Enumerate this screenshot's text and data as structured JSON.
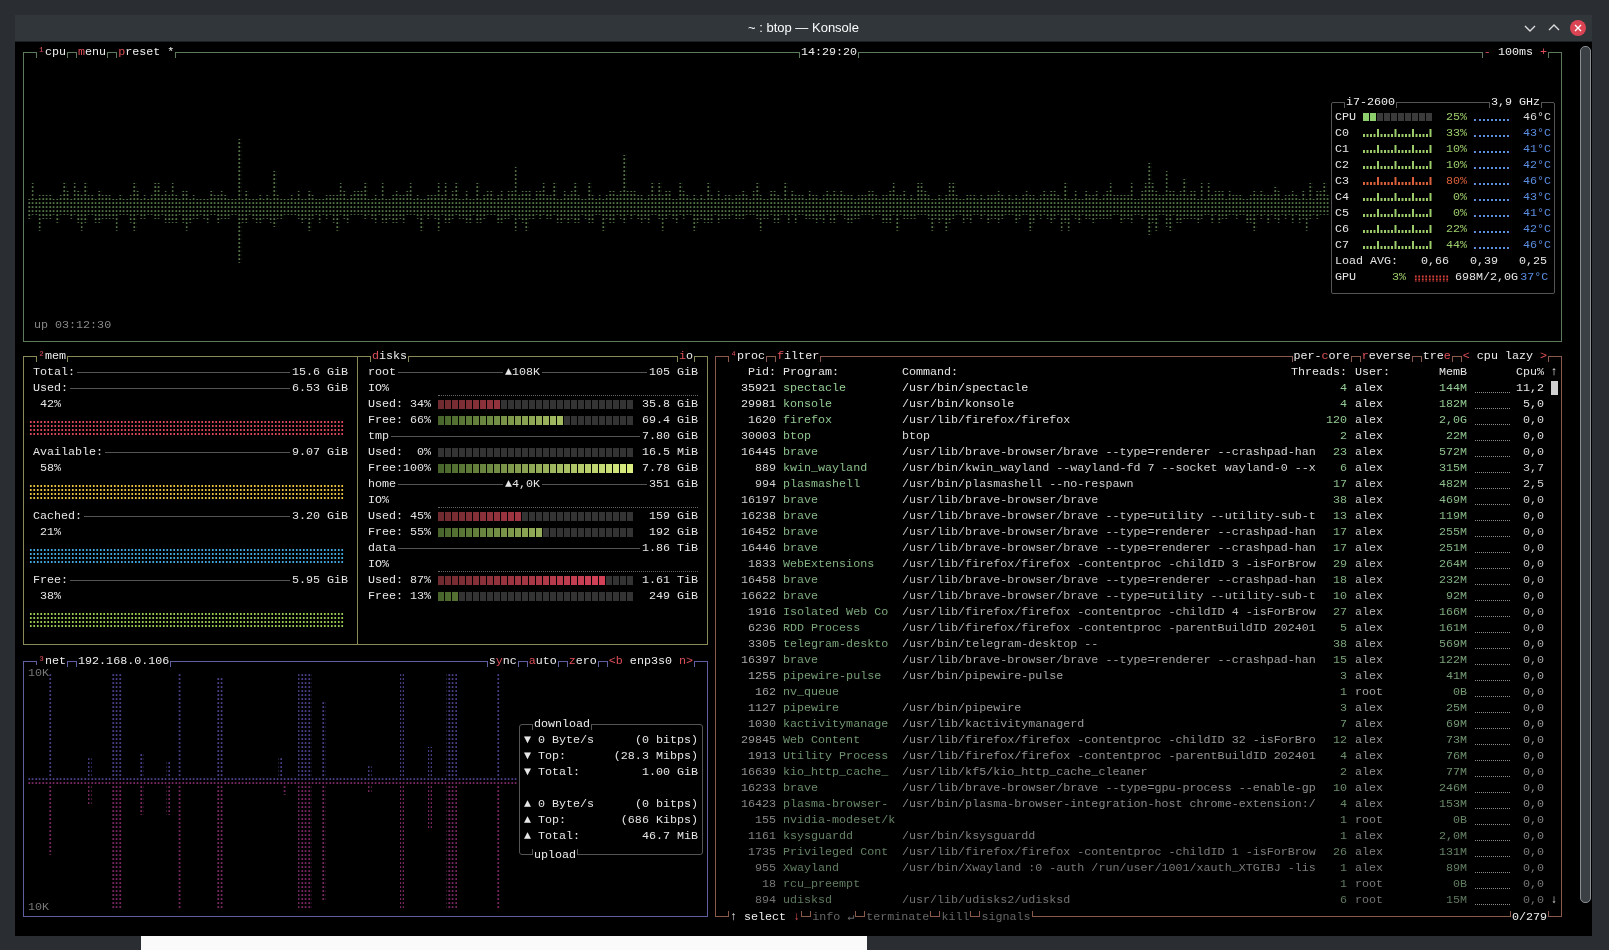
{
  "window": {
    "title": "~ : btop — Konsole"
  },
  "cpu": {
    "tabs": [
      "**¹**cpu",
      "**m**enu",
      "**p**reset *"
    ],
    "clock": "14:29:20",
    "interval": "**-** 100ms **+**",
    "uptime": "up 03:12:30",
    "stats": {
      "model": "i7-2600",
      "freq": "3,9 GHz",
      "total": {
        "label": "CPU",
        "level": 0.25,
        "percent": "25%",
        "temp": "46°C"
      },
      "cores": [
        {
          "label": "C0",
          "percent": "33%",
          "color": "#9ccc6a",
          "temp": "43°C"
        },
        {
          "label": "C1",
          "percent": "10%",
          "color": "#9ccc6a",
          "temp": "41°C"
        },
        {
          "label": "C2",
          "percent": "10%",
          "color": "#9ccc6a",
          "temp": "42°C"
        },
        {
          "label": "C3",
          "percent": "80%",
          "color": "#d9603b",
          "temp": "46°C"
        },
        {
          "label": "C4",
          "percent": "0%",
          "color": "#9ccc6a",
          "temp": "43°C"
        },
        {
          "label": "C5",
          "percent": "0%",
          "color": "#9ccc6a",
          "temp": "41°C"
        },
        {
          "label": "C6",
          "percent": "22%",
          "color": "#9ccc6a",
          "temp": "42°C"
        },
        {
          "label": "C7",
          "percent": "44%",
          "color": "#9ccc6a",
          "temp": "46°C"
        }
      ],
      "load": {
        "label": "Load AVG:",
        "values": [
          "0,66",
          "0,39",
          "0,25"
        ]
      },
      "gpu": {
        "label": "GPU",
        "percent": "3%",
        "memory": "698M/2,0G",
        "temp": "37°C"
      }
    }
  },
  "mem": {
    "title": "**²**mem",
    "items": [
      {
        "kind": "total",
        "label": "Total:",
        "value": "15.6 GiB"
      },
      {
        "kind": "meter",
        "label": "Used:",
        "value": "6.53 GiB",
        "percent": "42%",
        "color": "#d9485a"
      },
      {
        "kind": "meter",
        "label": "Available:",
        "value": "9.07 GiB",
        "percent": "58%",
        "color": "#e8c040"
      },
      {
        "kind": "meter",
        "label": "Cached:",
        "value": "3.20 GiB",
        "percent": "21%",
        "color": "#40a8e0"
      },
      {
        "kind": "meter",
        "label": "Free:",
        "value": "5.95 GiB",
        "percent": "38%",
        "color": "#98c850"
      }
    ]
  },
  "disks": {
    "title": "**d**isks",
    "io_title": "**i**o",
    "items": [
      {
        "name": "root",
        "io": "▲108K",
        "size": "105 GiB",
        "io_label": "IO%",
        "used": {
          "label": "Used: 34%",
          "level": 0.34,
          "value": "35.8 GiB"
        },
        "free": {
          "label": "Free: 66%",
          "level": 0.66,
          "value": "69.4 GiB"
        }
      },
      {
        "name": "tmp",
        "size": "7.80 GiB",
        "used": {
          "label": "Used:  0%",
          "level": 0,
          "value": "16.5 MiB"
        },
        "free": {
          "label": "Free:100%",
          "level": 1,
          "value": "7.78 GiB"
        }
      },
      {
        "name": "home",
        "io": "▲4,0K",
        "size": "351 GiB",
        "io_label": "IO%",
        "used": {
          "label": "Used: 45%",
          "level": 0.45,
          "value": "159 GiB"
        },
        "free": {
          "label": "Free: 55%",
          "level": 0.55,
          "value": "192 GiB"
        }
      },
      {
        "name": "data",
        "size": "1.86 TiB",
        "io_label": "IO%",
        "used": {
          "label": "Used: 87%",
          "level": 0.87,
          "value": "1.61 TiB"
        },
        "free": {
          "label": "Free: 13%",
          "level": 0.13,
          "value": "249 GiB"
        }
      }
    ]
  },
  "net": {
    "title": "**³**net",
    "address": "192.168.0.106",
    "options": [
      "s**y**nc",
      "**a**uto",
      "**z**ero",
      "**<b** enp3s0 **n>**"
    ],
    "scale_top": "10K",
    "scale_bottom": "10K",
    "download": {
      "title": "download",
      "rows": [
        {
          "arrow": "▼",
          "label": "0 Byte/s",
          "value": "(0 bitps)"
        },
        {
          "arrow": "▼",
          "label": "Top:",
          "value": "(28.3 Mibps)"
        },
        {
          "arrow": "▼",
          "label": "Total:",
          "value": "1.00 GiB"
        }
      ]
    },
    "upload": {
      "title": "upload",
      "rows": [
        {
          "arrow": "▲",
          "label": "0 Byte/s",
          "value": "(0 bitps)"
        },
        {
          "arrow": "▲",
          "label": "Top:",
          "value": "(686 Kibps)"
        },
        {
          "arrow": "▲",
          "label": "Total:",
          "value": "46.7 MiB"
        }
      ]
    }
  },
  "proc": {
    "title": "**⁴**proc",
    "filter": "**f**ilter",
    "options": [
      "per-**c**ore",
      "**r**everse",
      "tre**e**",
      "**<** cpu lazy **>**"
    ],
    "columns": [
      "Pid:",
      "Program:",
      "Command:",
      "Threads:",
      "User:",
      "MemB",
      "Cpu%"
    ],
    "scroll_up": "↑",
    "scroll_down": "↓",
    "rows": [
      {
        "pid": "35921",
        "program": "spectacle",
        "command": "/usr/bin/spectacle",
        "threads": "4",
        "user": "alex",
        "mem": "144M",
        "cpu": "11,2"
      },
      {
        "pid": "29981",
        "program": "konsole",
        "command": "/usr/bin/konsole",
        "threads": "4",
        "user": "alex",
        "mem": "182M",
        "cpu": "5,0"
      },
      {
        "pid": "1620",
        "program": "firefox",
        "command": "/usr/lib/firefox/firefox",
        "threads": "120",
        "user": "alex",
        "mem": "2,0G",
        "cpu": "0,0"
      },
      {
        "pid": "30003",
        "program": "btop",
        "command": "btop",
        "threads": "2",
        "user": "alex",
        "mem": "22M",
        "cpu": "0,0"
      },
      {
        "pid": "16445",
        "program": "brave",
        "command": "/usr/lib/brave-browser/brave --type=renderer --crashpad-han",
        "threads": "23",
        "user": "alex",
        "mem": "572M",
        "cpu": "0,0"
      },
      {
        "pid": "889",
        "program": "kwin_wayland",
        "command": "/usr/bin/kwin_wayland --wayland-fd 7 --socket wayland-0 --x",
        "threads": "6",
        "user": "alex",
        "mem": "315M",
        "cpu": "3,7"
      },
      {
        "pid": "994",
        "program": "plasmashell",
        "command": "/usr/bin/plasmashell --no-respawn",
        "threads": "17",
        "user": "alex",
        "mem": "482M",
        "cpu": "2,5"
      },
      {
        "pid": "16197",
        "program": "brave",
        "command": "/usr/lib/brave-browser/brave",
        "threads": "38",
        "user": "alex",
        "mem": "469M",
        "cpu": "0,0"
      },
      {
        "pid": "16238",
        "program": "brave",
        "command": "/usr/lib/brave-browser/brave --type=utility --utility-sub-t",
        "threads": "13",
        "user": "alex",
        "mem": "119M",
        "cpu": "0,0"
      },
      {
        "pid": "16452",
        "program": "brave",
        "command": "/usr/lib/brave-browser/brave --type=renderer --crashpad-han",
        "threads": "17",
        "user": "alex",
        "mem": "255M",
        "cpu": "0,0"
      },
      {
        "pid": "16446",
        "program": "brave",
        "command": "/usr/lib/brave-browser/brave --type=renderer --crashpad-han",
        "threads": "17",
        "user": "alex",
        "mem": "251M",
        "cpu": "0,0"
      },
      {
        "pid": "1833",
        "program": "WebExtensions",
        "command": "/usr/lib/firefox/firefox -contentproc -childID 3 -isForBrow",
        "threads": "29",
        "user": "alex",
        "mem": "264M",
        "cpu": "0,0"
      },
      {
        "pid": "16458",
        "program": "brave",
        "command": "/usr/lib/brave-browser/brave --type=renderer --crashpad-han",
        "threads": "18",
        "user": "alex",
        "mem": "232M",
        "cpu": "0,0"
      },
      {
        "pid": "16622",
        "program": "brave",
        "command": "/usr/lib/brave-browser/brave --type=utility --utility-sub-t",
        "threads": "10",
        "user": "alex",
        "mem": "92M",
        "cpu": "0,0"
      },
      {
        "pid": "1916",
        "program": "Isolated Web Co",
        "command": "/usr/lib/firefox/firefox -contentproc -childID 4 -isForBrow",
        "threads": "27",
        "user": "alex",
        "mem": "166M",
        "cpu": "0,0"
      },
      {
        "pid": "6236",
        "program": "RDD Process",
        "command": "/usr/lib/firefox/firefox -contentproc -parentBuildID 202401",
        "threads": "5",
        "user": "alex",
        "mem": "161M",
        "cpu": "0,0"
      },
      {
        "pid": "3305",
        "program": "telegram-deskto",
        "command": "/usr/bin/telegram-desktop --",
        "threads": "38",
        "user": "alex",
        "mem": "569M",
        "cpu": "0,0"
      },
      {
        "pid": "16397",
        "program": "brave",
        "command": "/usr/lib/brave-browser/brave --type=renderer --crashpad-han",
        "threads": "15",
        "user": "alex",
        "mem": "122M",
        "cpu": "0,0"
      },
      {
        "pid": "1255",
        "program": "pipewire-pulse",
        "command": "/usr/bin/pipewire-pulse",
        "threads": "3",
        "user": "alex",
        "mem": "41M",
        "cpu": "0,0"
      },
      {
        "pid": "162",
        "program": "nv_queue",
        "threads": "1",
        "user": "root",
        "mem": "0B",
        "cpu": "0,0"
      },
      {
        "pid": "1127",
        "program": "pipewire",
        "command": "/usr/bin/pipewire",
        "threads": "3",
        "user": "alex",
        "mem": "25M",
        "cpu": "0,0"
      },
      {
        "pid": "1030",
        "program": "kactivitymanage",
        "command": "/usr/lib/kactivitymanagerd",
        "threads": "7",
        "user": "alex",
        "mem": "69M",
        "cpu": "0,0"
      },
      {
        "pid": "29845",
        "program": "Web Content",
        "command": "/usr/lib/firefox/firefox -contentproc -childID 32 -isForBro",
        "threads": "12",
        "user": "alex",
        "mem": "73M",
        "cpu": "0,0"
      },
      {
        "pid": "1913",
        "program": "Utility Process",
        "command": "/usr/lib/firefox/firefox -contentproc -parentBuildID 202401",
        "threads": "4",
        "user": "alex",
        "mem": "76M",
        "cpu": "0,0"
      },
      {
        "pid": "16639",
        "program": "kio_http_cache_",
        "command": "/usr/lib/kf5/kio_http_cache_cleaner",
        "threads": "2",
        "user": "alex",
        "mem": "77M",
        "cpu": "0,0"
      },
      {
        "pid": "16233",
        "program": "brave",
        "command": "/usr/lib/brave-browser/brave --type=gpu-process --enable-gp",
        "threads": "10",
        "user": "alex",
        "mem": "246M",
        "cpu": "0,0"
      },
      {
        "pid": "16423",
        "program": "plasma-browser-",
        "command": "/usr/bin/plasma-browser-integration-host chrome-extension:/",
        "threads": "4",
        "user": "alex",
        "mem": "153M",
        "cpu": "0,0"
      },
      {
        "pid": "155",
        "program": "nvidia-modeset/k",
        "threads": "1",
        "user": "root",
        "mem": "0B",
        "cpu": "0,0"
      },
      {
        "pid": "1161",
        "program": "ksysguardd",
        "command": "/usr/bin/ksysguardd",
        "threads": "1",
        "user": "alex",
        "mem": "2,0M",
        "cpu": "0,0"
      },
      {
        "pid": "1735",
        "program": "Privileged Cont",
        "command": "/usr/lib/firefox/firefox -contentproc -childID 1 -isForBrow",
        "threads": "26",
        "user": "alex",
        "mem": "131M",
        "cpu": "0,0"
      },
      {
        "pid": "955",
        "program": "Xwayland",
        "command": "/usr/bin/Xwayland :0 -auth /run/user/1001/xauth_XTGIBJ -lis",
        "threads": "1",
        "user": "alex",
        "mem": "89M",
        "cpu": "0,0"
      },
      {
        "pid": "18",
        "program": "rcu_preempt",
        "threads": "1",
        "user": "root",
        "mem": "0B",
        "cpu": "0,0"
      },
      {
        "pid": "894",
        "program": "udisksd",
        "command": "/usr/lib/udisks2/udisksd",
        "threads": "6",
        "user": "root",
        "mem": "15M",
        "cpu": "0,0"
      }
    ],
    "footer": [
      {
        "label": "↑ select **↓**",
        "disabled": false
      },
      {
        "label": "info ↵",
        "disabled": true
      },
      {
        "label": "terminate",
        "disabled": true
      },
      {
        "label": "kill",
        "disabled": true
      },
      {
        "label": "signals",
        "disabled": true
      }
    ],
    "count": "0/279"
  }
}
